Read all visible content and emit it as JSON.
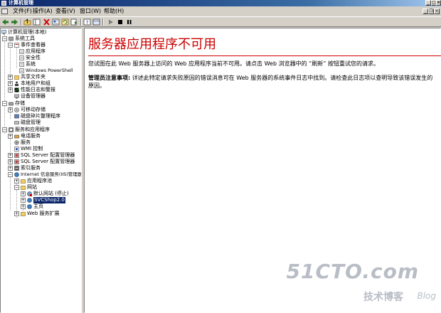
{
  "window": {
    "title": "计算机管理"
  },
  "menu": [
    "文件(F)",
    "操作(A)",
    "查看(V)",
    "窗口(W)",
    "帮助(H)"
  ],
  "toolbar_icons": [
    "back-icon",
    "forward-icon",
    "up-icon",
    "show-hide-tree-icon",
    "delete-icon",
    "properties-icon",
    "refresh-icon",
    "export-icon",
    "help-icon",
    "view-icon",
    "play-icon",
    "stop-icon",
    "pause-icon"
  ],
  "tree": [
    {
      "label": "计算机管理(本地)",
      "icon": "computer-icon"
    },
    {
      "label": "系统工具",
      "icon": "tools-icon"
    },
    {
      "label": "事件查看器",
      "icon": "event-viewer-icon"
    },
    {
      "label": "应用程序",
      "icon": "log-icon"
    },
    {
      "label": "安全性",
      "icon": "log-icon"
    },
    {
      "label": "系统",
      "icon": "log-icon"
    },
    {
      "label": "Windows PowerShell",
      "icon": "log-icon"
    },
    {
      "label": "共享文件夹",
      "icon": "shared-folder-icon"
    },
    {
      "label": "本地用户和组",
      "icon": "users-icon"
    },
    {
      "label": "性能日志和警报",
      "icon": "performance-icon"
    },
    {
      "label": "设备管理器",
      "icon": "device-manager-icon"
    },
    {
      "label": "存储",
      "icon": "storage-icon"
    },
    {
      "label": "可移动存储",
      "icon": "removable-storage-icon"
    },
    {
      "label": "磁盘碎片整理程序",
      "icon": "defrag-icon"
    },
    {
      "label": "磁盘管理",
      "icon": "disk-icon"
    },
    {
      "label": "服务和应用程序",
      "icon": "services-apps-icon"
    },
    {
      "label": "电话服务",
      "icon": "phone-icon"
    },
    {
      "label": "服务",
      "icon": "services-icon"
    },
    {
      "label": "WMI 控制",
      "icon": "wmi-icon"
    },
    {
      "label": "SQL Server 配置管理器",
      "icon": "sql-icon"
    },
    {
      "label": "SQL Server 配置管理器",
      "icon": "sql-icon"
    },
    {
      "label": "索引服务",
      "icon": "index-icon"
    },
    {
      "label": "Internet 信息服务(IIS)管理器",
      "icon": "iis-icon"
    },
    {
      "label": "应用程序池",
      "icon": "folder-icon"
    },
    {
      "label": "网站",
      "icon": "folder-icon"
    },
    {
      "label": "默认网站 (停止)",
      "icon": "website-stopped-icon"
    },
    {
      "label": "SVCShop2.0",
      "icon": "website-icon"
    },
    {
      "label": "主页",
      "icon": "website-icon"
    },
    {
      "label": "Web 服务扩展",
      "icon": "folder-icon"
    }
  ],
  "content": {
    "title": "服务器应用程序不可用",
    "description": "您试图在此 Web 服务器上访问的 Web 应用程序当前不可用。请点击 Web 浏览器中的 “刷新” 按钮重试您的请求。",
    "note_label": "管理员注意事项:",
    "note_text": " 详述此特定请求失败原因的错误消息可在 Web 服务器的系统事件日志中找到。请检查此日志项以查明导致该错误发生的原因。"
  },
  "watermark": {
    "big": "51CTO.com",
    "small": "技术博客",
    "blog": "Blog"
  },
  "colors": {
    "error_red": "#cc0000",
    "selection": "#0a246a",
    "titlebar": "#0a246a"
  }
}
